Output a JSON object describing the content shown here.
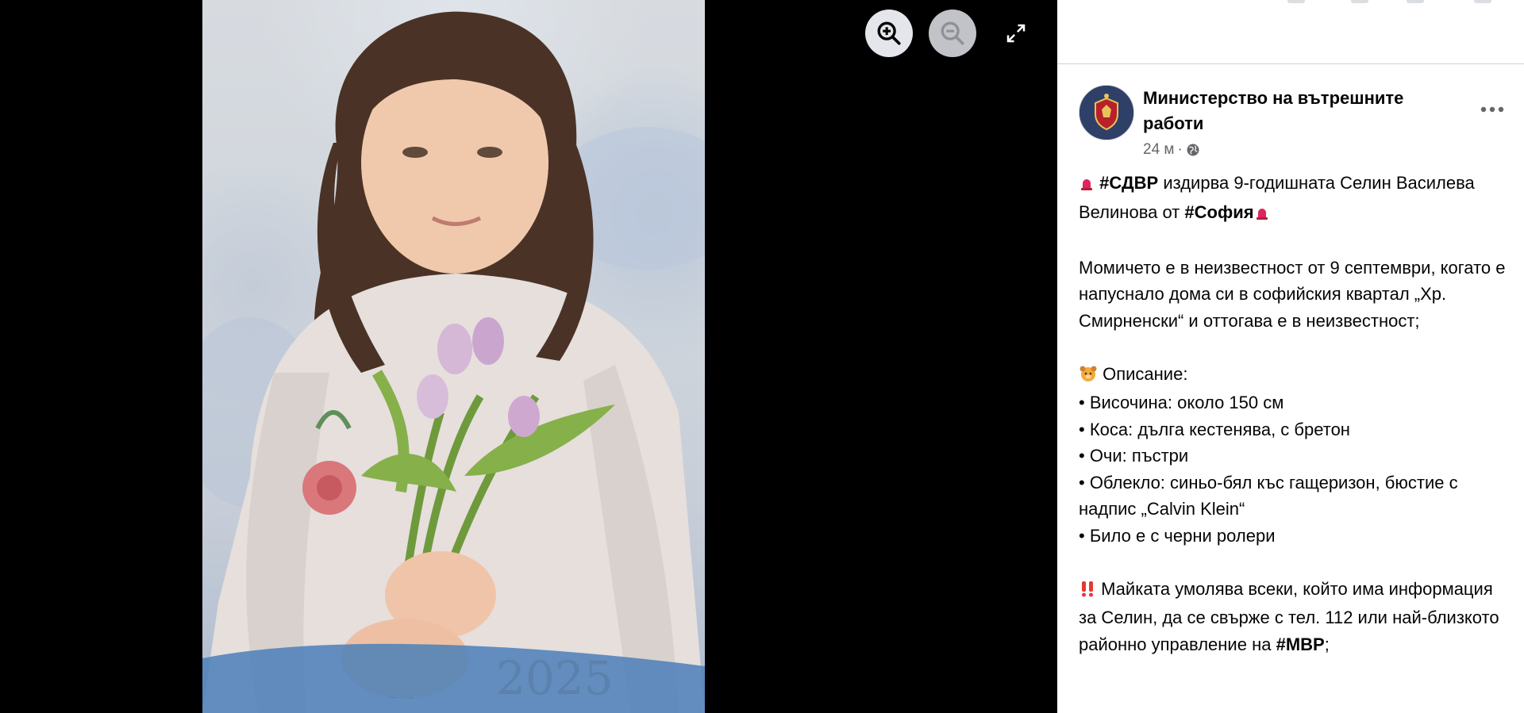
{
  "viewer": {
    "controls": {
      "zoom_in": "zoom-in-icon",
      "zoom_out": "zoom-out-icon",
      "fullscreen": "fullscreen-icon"
    },
    "photo_caption_year": "2025"
  },
  "post": {
    "page_name": "Министерство на вътрешните работи",
    "timestamp": "24 м",
    "separator": "·",
    "privacy_icon": "globe-icon",
    "more_icon": "more-horizontal-icon",
    "body": {
      "line1": {
        "emoji": "siren",
        "hashtag1": "#СДВР",
        "text1": " издирва 9-годишната Селин Василева Велинова от ",
        "hashtag2": "#София",
        "emoji_end": "siren"
      },
      "para2": "Момичето е в неизвестност от 9 септември, когато е напуснало дома си в софийския квартал „Хр. Смирненски“ и оттогава е в неизвестност;",
      "desc_heading": " Описание:",
      "desc_emoji": "face",
      "bullets": [
        "• Височина: около 150 см",
        "• Коса: дълга кестенява, с бретон",
        "• Очи: пъстри",
        "• Облекло: синьо-бял къс гащеризон, бюстие с надпис „Calvin Klein“",
        "• Било е с черни ролери"
      ],
      "para4": {
        "emoji": "double-exclamation",
        "text": " Майката умолява всеки, който има информация за Селин, да се свърже с тел. 112 или най-близкото районно управление на ",
        "hashtag": "#МВР",
        "tail": ";"
      }
    }
  },
  "colors": {
    "panel_bg": "#ffffff",
    "viewer_bg": "#000000",
    "text_primary": "#050505",
    "text_secondary": "#65676b",
    "control_bg": "#e4e6eb",
    "siren_red": "#e0245e",
    "alert_red": "#e53935"
  }
}
